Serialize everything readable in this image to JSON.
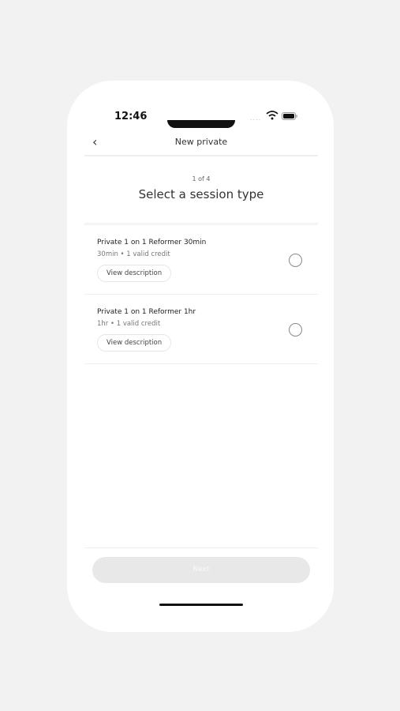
{
  "status_bar": {
    "time": "12:46",
    "signal_icon": "signal-dots-icon",
    "wifi_icon": "wifi-icon",
    "battery_icon": "battery-icon"
  },
  "nav": {
    "back_glyph": "‹",
    "title": "New private"
  },
  "header": {
    "step": "1 of 4",
    "title": "Select a session type"
  },
  "sessions": [
    {
      "name": "Private 1 on 1 Reformer 30min",
      "meta": "30min • 1 valid credit",
      "button": "View description",
      "selected": false
    },
    {
      "name": "Private 1 on 1 Reformer 1hr",
      "meta": "1hr • 1 valid credit",
      "button": "View description",
      "selected": false
    }
  ],
  "footer": {
    "next_label": "Next",
    "next_enabled": false
  }
}
